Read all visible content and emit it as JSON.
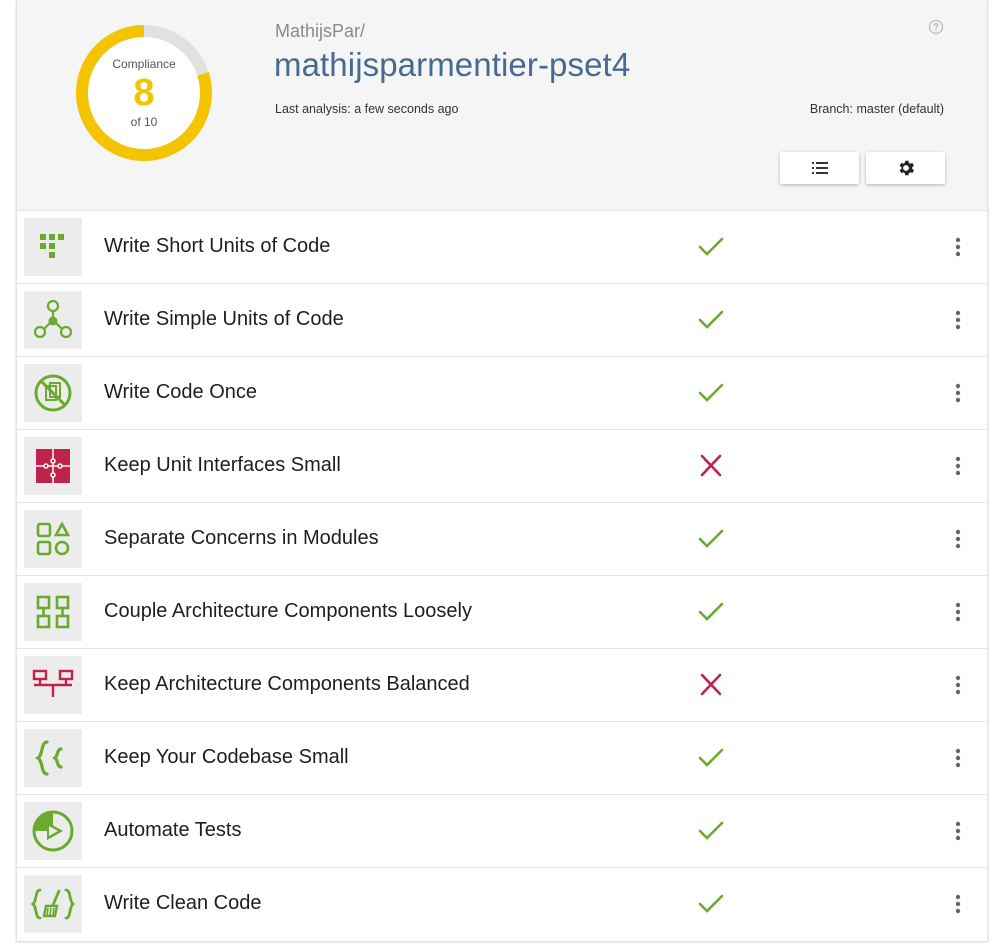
{
  "compliance": {
    "label": "Compliance",
    "value": "8",
    "of_text": "of 10",
    "score": 8,
    "max": 10,
    "ring_color": "#f5c400",
    "track_color": "#e1e1e1"
  },
  "repository": {
    "owner": "MathijsPar/",
    "name": "mathijsparmentier-pset4",
    "last_analysis": "Last analysis: a few seconds ago",
    "branch": "Branch: master (default)"
  },
  "toolbar": {
    "list_icon": "list-icon",
    "settings_icon": "gear-icon",
    "help_icon": "help-circle-icon"
  },
  "colors": {
    "pass": "#6aaa2e",
    "fail": "#c0234a",
    "accent_blue": "#466a91"
  },
  "guidelines": [
    {
      "label": "Write Short Units of Code",
      "icon": "short-units-icon",
      "status": "pass"
    },
    {
      "label": "Write Simple Units of Code",
      "icon": "simple-units-icon",
      "status": "pass"
    },
    {
      "label": "Write Code Once",
      "icon": "no-duplication-icon",
      "status": "pass"
    },
    {
      "label": "Keep Unit Interfaces Small",
      "icon": "puzzle-icon",
      "status": "fail"
    },
    {
      "label": "Separate Concerns in Modules",
      "icon": "modules-icon",
      "status": "pass"
    },
    {
      "label": "Couple Architecture Components Loosely",
      "icon": "components-icon",
      "status": "pass"
    },
    {
      "label": "Keep Architecture Components Balanced",
      "icon": "balance-icon",
      "status": "fail"
    },
    {
      "label": "Keep Your Codebase Small",
      "icon": "braces-icon",
      "status": "pass"
    },
    {
      "label": "Automate Tests",
      "icon": "automate-tests-icon",
      "status": "pass"
    },
    {
      "label": "Write Clean Code",
      "icon": "clean-code-icon",
      "status": "pass"
    }
  ]
}
